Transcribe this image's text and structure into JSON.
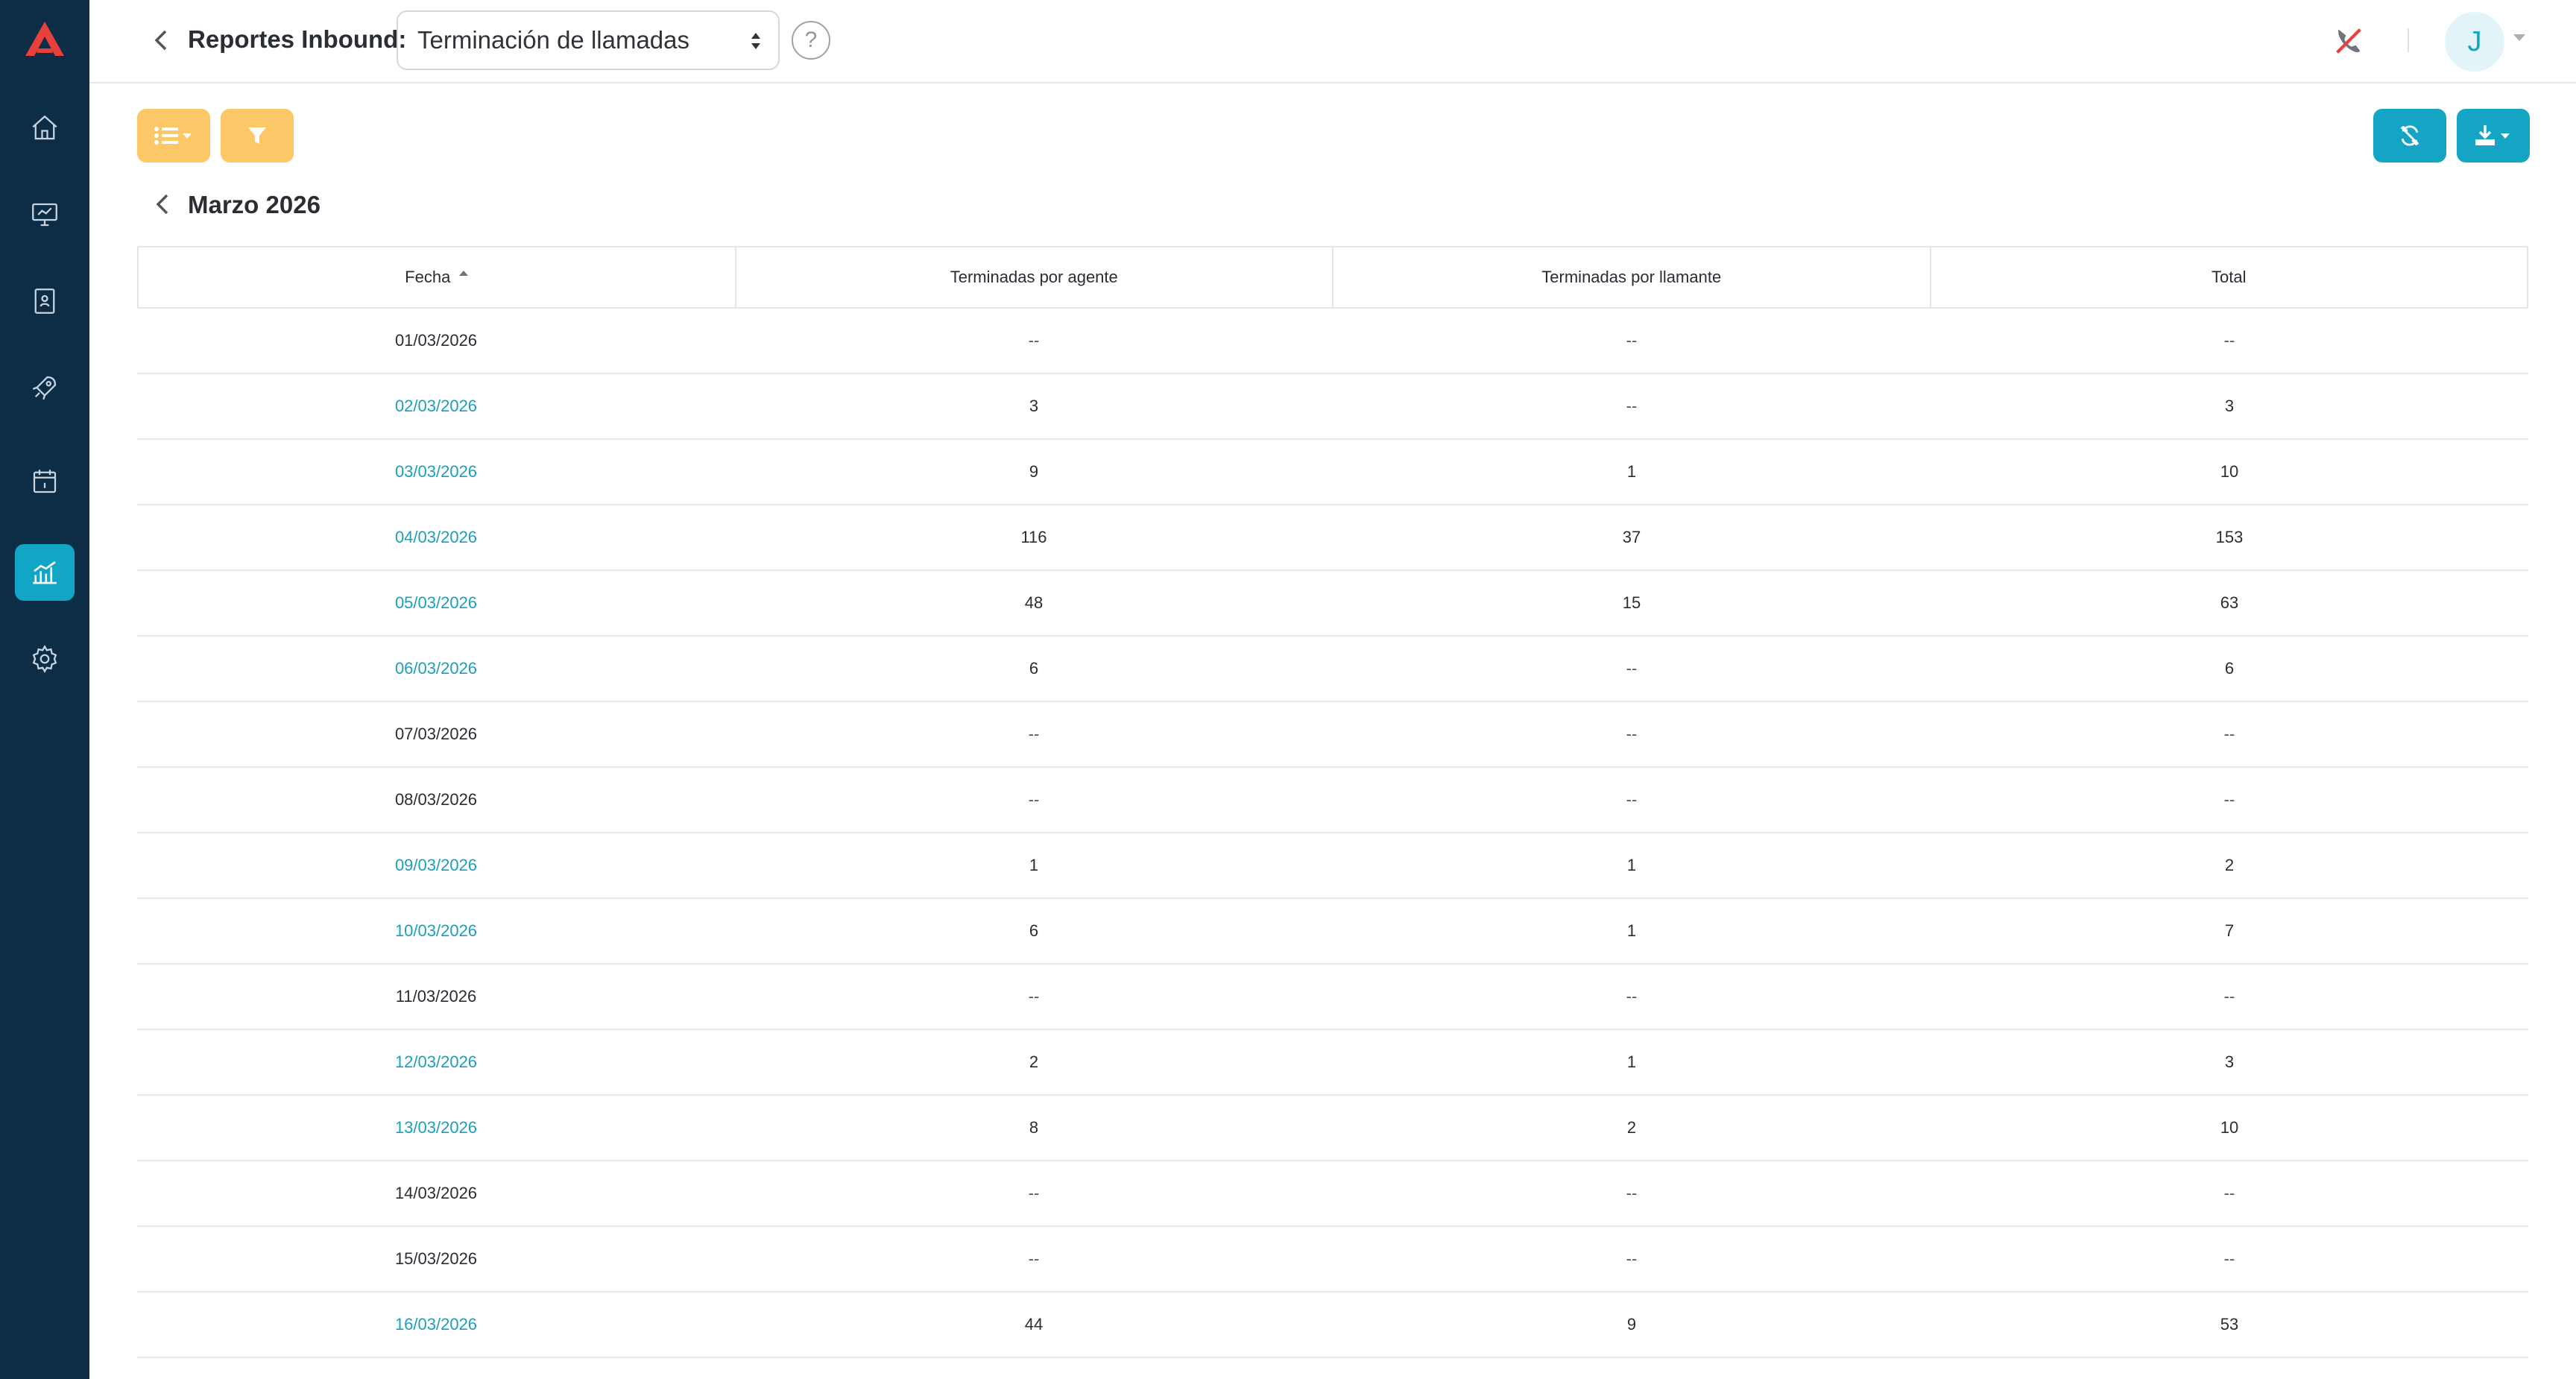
{
  "colors": {
    "sidebar": "#0d2c45",
    "accent": "#12a6c6",
    "warning": "#fcc766",
    "logo": "#e8413c"
  },
  "sidebar": {
    "items": [
      {
        "icon": "home-icon",
        "active": false
      },
      {
        "icon": "monitor-icon",
        "active": false
      },
      {
        "icon": "contacts-book-icon",
        "active": false
      },
      {
        "icon": "rocket-icon",
        "active": false
      },
      {
        "icon": "calendar-icon",
        "active": false
      },
      {
        "icon": "chart-icon",
        "active": true
      },
      {
        "icon": "gear-icon",
        "active": false
      }
    ]
  },
  "header": {
    "title": "Reportes Inbound:",
    "report_selected": "Terminación de llamadas",
    "help_label": "?",
    "avatar_initial": "J"
  },
  "toolbar": {
    "list_button_icon": "list-icon",
    "filter_button_icon": "filter-icon",
    "sync_button_icon": "sync-icon",
    "download_button_icon": "download-icon"
  },
  "period": {
    "title": "Marzo 2026"
  },
  "table": {
    "columns": [
      "Fecha",
      "Terminadas por agente",
      "Terminadas por llamante",
      "Total"
    ],
    "rows": [
      {
        "date": "01/03/2026",
        "agent": "--",
        "caller": "--",
        "total": "--",
        "link": false
      },
      {
        "date": "02/03/2026",
        "agent": "3",
        "caller": "--",
        "total": "3",
        "link": true
      },
      {
        "date": "03/03/2026",
        "agent": "9",
        "caller": "1",
        "total": "10",
        "link": true
      },
      {
        "date": "04/03/2026",
        "agent": "116",
        "caller": "37",
        "total": "153",
        "link": true
      },
      {
        "date": "05/03/2026",
        "agent": "48",
        "caller": "15",
        "total": "63",
        "link": true
      },
      {
        "date": "06/03/2026",
        "agent": "6",
        "caller": "--",
        "total": "6",
        "link": true
      },
      {
        "date": "07/03/2026",
        "agent": "--",
        "caller": "--",
        "total": "--",
        "link": false
      },
      {
        "date": "08/03/2026",
        "agent": "--",
        "caller": "--",
        "total": "--",
        "link": false
      },
      {
        "date": "09/03/2026",
        "agent": "1",
        "caller": "1",
        "total": "2",
        "link": true
      },
      {
        "date": "10/03/2026",
        "agent": "6",
        "caller": "1",
        "total": "7",
        "link": true
      },
      {
        "date": "11/03/2026",
        "agent": "--",
        "caller": "--",
        "total": "--",
        "link": false
      },
      {
        "date": "12/03/2026",
        "agent": "2",
        "caller": "1",
        "total": "3",
        "link": true
      },
      {
        "date": "13/03/2026",
        "agent": "8",
        "caller": "2",
        "total": "10",
        "link": true
      },
      {
        "date": "14/03/2026",
        "agent": "--",
        "caller": "--",
        "total": "--",
        "link": false
      },
      {
        "date": "15/03/2026",
        "agent": "--",
        "caller": "--",
        "total": "--",
        "link": false
      },
      {
        "date": "16/03/2026",
        "agent": "44",
        "caller": "9",
        "total": "53",
        "link": true
      }
    ]
  }
}
